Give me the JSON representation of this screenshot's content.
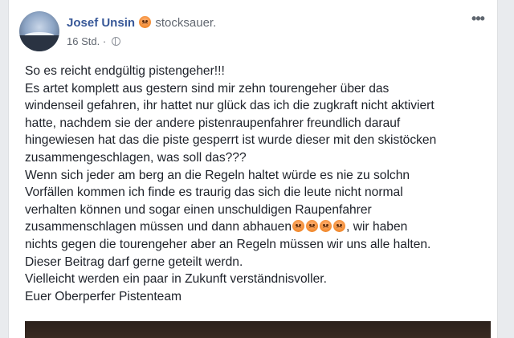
{
  "post": {
    "author": "Josef Unsin",
    "feeling_emoji": "angry-face-emoji",
    "feeling": "stocksauer.",
    "timestamp": "16 Std.",
    "separator": " · ",
    "audience_icon": "globe-icon",
    "more_icon": "more-options-icon",
    "more_label": "•••",
    "lines": [
      "So es reicht endgültig pistengeher!!!",
      "Es artet komplett aus gestern sind mir zehn tourengeher über das",
      "windenseil gefahren, ihr hattet nur glück das ich die zugkraft nicht aktiviert",
      "hatte, nachdem sie der andere pistenraupenfahrer freundlich darauf",
      "hingewiesen hat das die piste gesperrt ist wurde dieser mit den skistöcken",
      "zusammengeschlagen, was soll das???",
      "Wenn sich jeder am berg an die Regeln haltet würde es nie zu solchn",
      "Vorfällen kommen ich finde es traurig das sich die leute nicht normal",
      "verhalten können und sogar einen unschuldigen Raupenfahrer"
    ],
    "line_emoji_before": "zusammenschlagen müssen und dann abhauen",
    "line_emoji_after": ", wir haben",
    "inline_emoji_count": 4,
    "lines_after": [
      "nichts gegen die tourengeher aber an Regeln müssen wir uns alle halten.",
      "Dieser Beitrag darf gerne geteilt werdn.",
      "Vielleicht werden ein paar in Zukunft verständnisvoller.",
      "Euer Oberperfer Pistenteam"
    ]
  },
  "colors": {
    "author_link": "#385898",
    "text": "#1d2129",
    "meta": "#616770",
    "background": "#e9ebee"
  }
}
